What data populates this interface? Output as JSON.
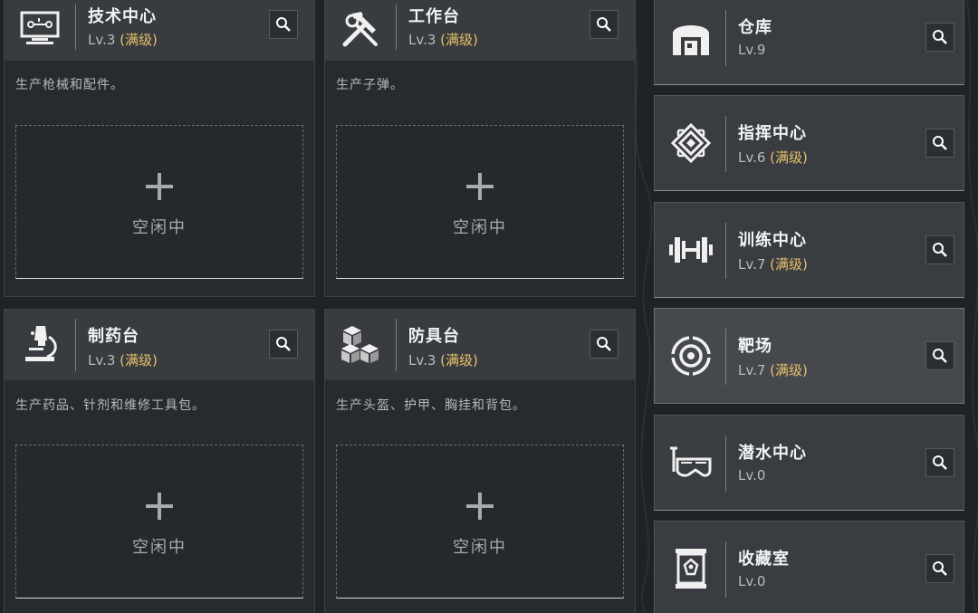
{
  "colors": {
    "max_level": "#e8c06a",
    "background": "#1f2226"
  },
  "production": [
    {
      "name": "技术中心",
      "level": "Lv.3",
      "max": "(满级)",
      "desc": "生产枪械和配件。",
      "icon": "computer-icon",
      "slot": "空闲中"
    },
    {
      "name": "工作台",
      "level": "Lv.3",
      "max": "(满级)",
      "desc": "生产子弹。",
      "icon": "hammer-wrench-icon",
      "slot": "空闲中"
    },
    {
      "name": "制药台",
      "level": "Lv.3",
      "max": "(满级)",
      "desc": "生产药品、针剂和维修工具包。",
      "icon": "microscope-icon",
      "slot": "空闲中"
    },
    {
      "name": "防具台",
      "level": "Lv.3",
      "max": "(满级)",
      "desc": "生产头盔、护甲、胸挂和背包。",
      "icon": "armor-boxes-icon",
      "slot": "空闲中"
    }
  ],
  "facilities": [
    {
      "name": "仓库",
      "level": "Lv.9",
      "max": "",
      "icon": "warehouse-icon"
    },
    {
      "name": "指挥中心",
      "level": "Lv.6",
      "max": "(满级)",
      "icon": "command-emblem-icon"
    },
    {
      "name": "训练中心",
      "level": "Lv.7",
      "max": "(满级)",
      "icon": "dumbbell-icon"
    },
    {
      "name": "靶场",
      "level": "Lv.7",
      "max": "(满级)",
      "icon": "target-icon"
    },
    {
      "name": "潜水中心",
      "level": "Lv.0",
      "max": "",
      "icon": "diving-mask-icon"
    },
    {
      "name": "收藏室",
      "level": "Lv.0",
      "max": "",
      "icon": "display-case-icon"
    }
  ]
}
